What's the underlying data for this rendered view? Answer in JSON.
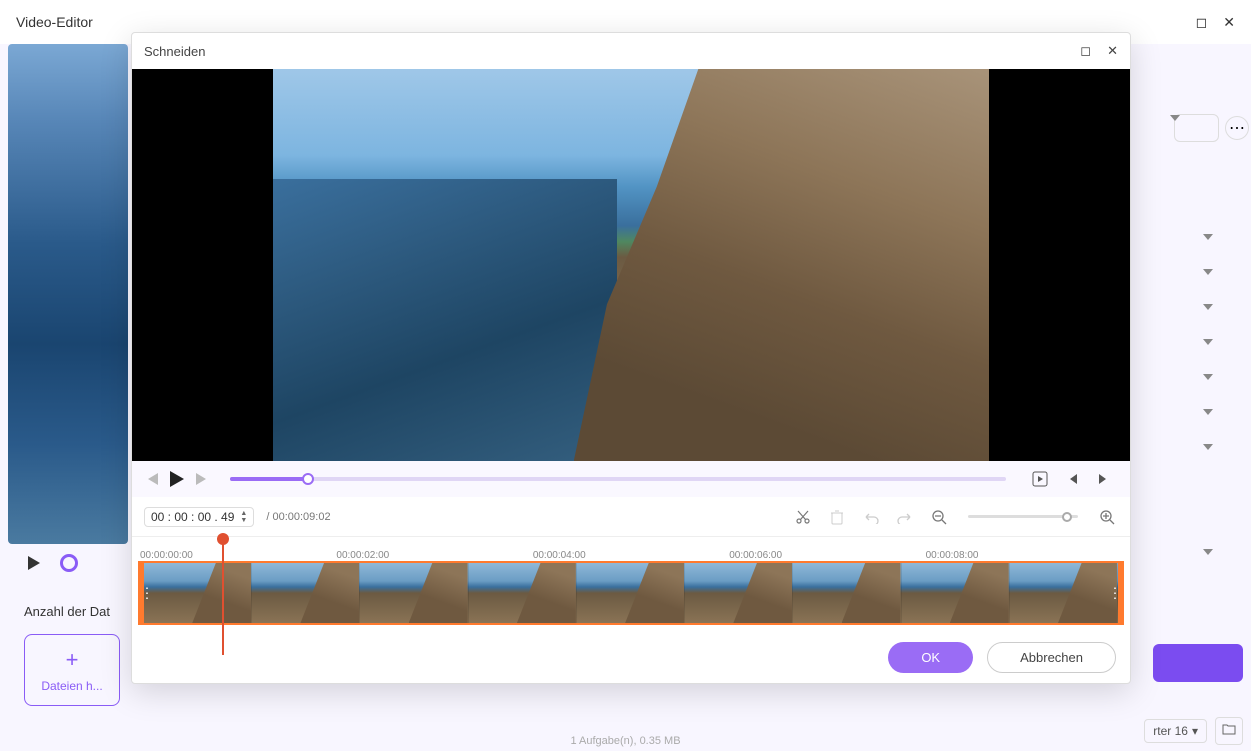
{
  "main": {
    "title": "Video-Editor",
    "anzahl_label": "Anzahl der Dat",
    "add_files_label": "Dateien h...",
    "right_dropdown_hint": "rter 16",
    "status_bar": "1 Aufgabe(n), 0.35 MB"
  },
  "modal": {
    "title": "Schneiden",
    "time_current": "00 : 00 : 00 . 49",
    "time_total": "/ 00:00:09:02",
    "ruler": [
      "00:00:00:00",
      "00:00:02:00",
      "00:00:04:00",
      "00:00:06:00",
      "00:00:08:00"
    ],
    "ok_label": "OK",
    "cancel_label": "Abbrechen"
  }
}
